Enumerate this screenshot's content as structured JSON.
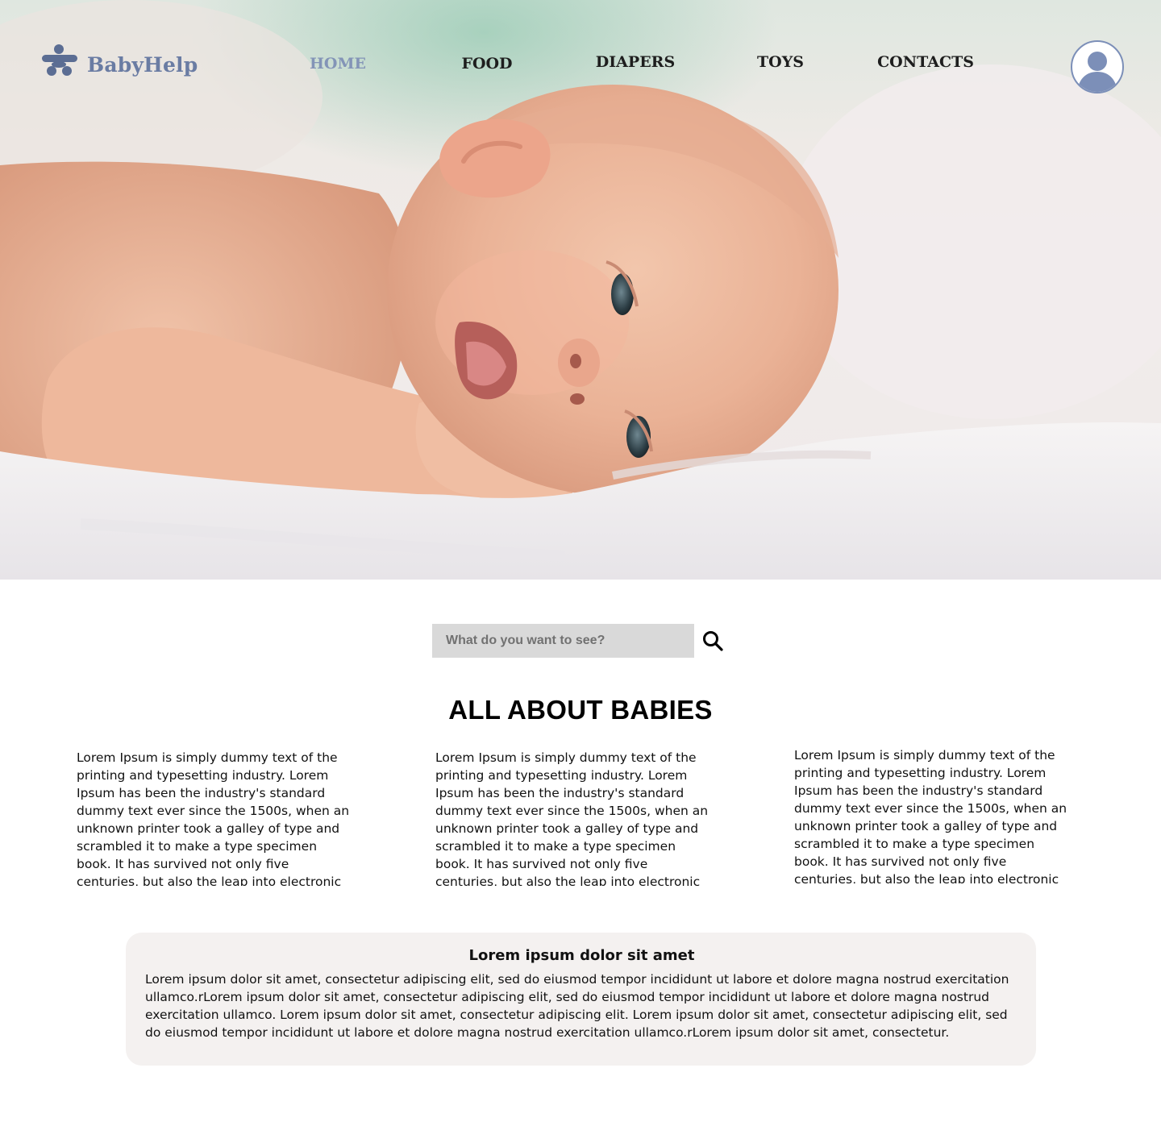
{
  "brand": {
    "name": "BabyHelp",
    "color": "#6a7ca3"
  },
  "nav": {
    "items": [
      {
        "label": "HOME",
        "active": true
      },
      {
        "label": "FOOD",
        "active": false
      },
      {
        "label": "DIAPERS",
        "active": false
      },
      {
        "label": "TOYS",
        "active": false
      },
      {
        "label": "CONTACTS",
        "active": false
      }
    ],
    "active_color": "#8394b7"
  },
  "profile": {
    "icon": "user-avatar-icon"
  },
  "search": {
    "placeholder": "What do you want to see?",
    "value": "",
    "icon": "search-icon"
  },
  "section": {
    "title": "ALL ABOUT BABIES"
  },
  "columns": [
    {
      "text": "Lorem Ipsum is simply dummy text of the printing and typesetting industry. Lorem Ipsum has been the industry's standard dummy text ever since the 1500s, when an unknown printer took a galley of type and scrambled it to make a type specimen book. It has survived not only five centuries, but also the leap into electronic typesetting,"
    },
    {
      "text": "Lorem Ipsum is simply dummy text of the printing and typesetting industry. Lorem Ipsum has been the industry's standard dummy text ever since the 1500s, when an unknown printer took a galley of type and scrambled it to make a type specimen book. It has survived not only five centuries, but also the leap into electronic typesetting,"
    },
    {
      "text": "Lorem Ipsum is simply dummy text of the printing and typesetting industry. Lorem Ipsum has been the industry's standard dummy text ever since the 1500s, when an unknown printer took a galley of type and scrambled it to make a type specimen book. It has survived not only five centuries, but also the leap into electronic typesetting,"
    }
  ],
  "info_card": {
    "title": "Lorem ipsum dolor sit amet",
    "body": "Lorem ipsum dolor sit amet, consectetur adipiscing elit, sed do eiusmod tempor incididunt ut labore et dolore magna  nostrud exercitation ullamco.rLorem ipsum dolor sit amet, consectetur adipiscing elit, sed do eiusmod tempor incididunt ut labore et dolore magna  nostrud exercitation ullamco. Lorem ipsum dolor sit amet, consectetur adipiscing elit. Lorem ipsum dolor sit amet, consectetur adipiscing elit, sed do eiusmod tempor incididunt ut labore et dolore magna  nostrud exercitation ullamco.rLorem ipsum dolor sit amet, consectetur.",
    "background": "#f4f1f0"
  },
  "hero": {
    "image": "smiling-baby-lying-on-bed-photo"
  }
}
